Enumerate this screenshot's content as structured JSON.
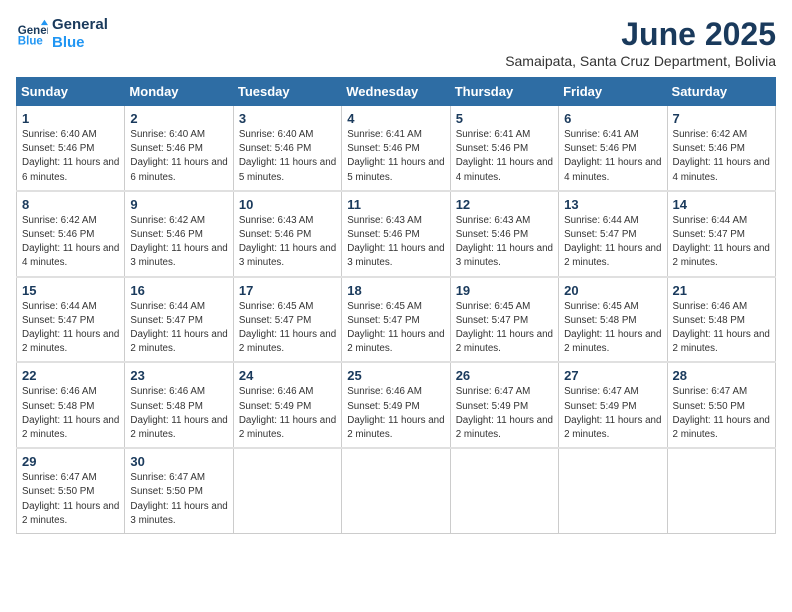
{
  "logo": {
    "line1": "General",
    "line2": "Blue"
  },
  "title": "June 2025",
  "subtitle": "Samaipata, Santa Cruz Department, Bolivia",
  "days_of_week": [
    "Sunday",
    "Monday",
    "Tuesday",
    "Wednesday",
    "Thursday",
    "Friday",
    "Saturday"
  ],
  "weeks": [
    [
      {
        "day": "1",
        "sunrise": "Sunrise: 6:40 AM",
        "sunset": "Sunset: 5:46 PM",
        "daylight": "Daylight: 11 hours and 6 minutes."
      },
      {
        "day": "2",
        "sunrise": "Sunrise: 6:40 AM",
        "sunset": "Sunset: 5:46 PM",
        "daylight": "Daylight: 11 hours and 6 minutes."
      },
      {
        "day": "3",
        "sunrise": "Sunrise: 6:40 AM",
        "sunset": "Sunset: 5:46 PM",
        "daylight": "Daylight: 11 hours and 5 minutes."
      },
      {
        "day": "4",
        "sunrise": "Sunrise: 6:41 AM",
        "sunset": "Sunset: 5:46 PM",
        "daylight": "Daylight: 11 hours and 5 minutes."
      },
      {
        "day": "5",
        "sunrise": "Sunrise: 6:41 AM",
        "sunset": "Sunset: 5:46 PM",
        "daylight": "Daylight: 11 hours and 4 minutes."
      },
      {
        "day": "6",
        "sunrise": "Sunrise: 6:41 AM",
        "sunset": "Sunset: 5:46 PM",
        "daylight": "Daylight: 11 hours and 4 minutes."
      },
      {
        "day": "7",
        "sunrise": "Sunrise: 6:42 AM",
        "sunset": "Sunset: 5:46 PM",
        "daylight": "Daylight: 11 hours and 4 minutes."
      }
    ],
    [
      {
        "day": "8",
        "sunrise": "Sunrise: 6:42 AM",
        "sunset": "Sunset: 5:46 PM",
        "daylight": "Daylight: 11 hours and 4 minutes."
      },
      {
        "day": "9",
        "sunrise": "Sunrise: 6:42 AM",
        "sunset": "Sunset: 5:46 PM",
        "daylight": "Daylight: 11 hours and 3 minutes."
      },
      {
        "day": "10",
        "sunrise": "Sunrise: 6:43 AM",
        "sunset": "Sunset: 5:46 PM",
        "daylight": "Daylight: 11 hours and 3 minutes."
      },
      {
        "day": "11",
        "sunrise": "Sunrise: 6:43 AM",
        "sunset": "Sunset: 5:46 PM",
        "daylight": "Daylight: 11 hours and 3 minutes."
      },
      {
        "day": "12",
        "sunrise": "Sunrise: 6:43 AM",
        "sunset": "Sunset: 5:46 PM",
        "daylight": "Daylight: 11 hours and 3 minutes."
      },
      {
        "day": "13",
        "sunrise": "Sunrise: 6:44 AM",
        "sunset": "Sunset: 5:47 PM",
        "daylight": "Daylight: 11 hours and 2 minutes."
      },
      {
        "day": "14",
        "sunrise": "Sunrise: 6:44 AM",
        "sunset": "Sunset: 5:47 PM",
        "daylight": "Daylight: 11 hours and 2 minutes."
      }
    ],
    [
      {
        "day": "15",
        "sunrise": "Sunrise: 6:44 AM",
        "sunset": "Sunset: 5:47 PM",
        "daylight": "Daylight: 11 hours and 2 minutes."
      },
      {
        "day": "16",
        "sunrise": "Sunrise: 6:44 AM",
        "sunset": "Sunset: 5:47 PM",
        "daylight": "Daylight: 11 hours and 2 minutes."
      },
      {
        "day": "17",
        "sunrise": "Sunrise: 6:45 AM",
        "sunset": "Sunset: 5:47 PM",
        "daylight": "Daylight: 11 hours and 2 minutes."
      },
      {
        "day": "18",
        "sunrise": "Sunrise: 6:45 AM",
        "sunset": "Sunset: 5:47 PM",
        "daylight": "Daylight: 11 hours and 2 minutes."
      },
      {
        "day": "19",
        "sunrise": "Sunrise: 6:45 AM",
        "sunset": "Sunset: 5:47 PM",
        "daylight": "Daylight: 11 hours and 2 minutes."
      },
      {
        "day": "20",
        "sunrise": "Sunrise: 6:45 AM",
        "sunset": "Sunset: 5:48 PM",
        "daylight": "Daylight: 11 hours and 2 minutes."
      },
      {
        "day": "21",
        "sunrise": "Sunrise: 6:46 AM",
        "sunset": "Sunset: 5:48 PM",
        "daylight": "Daylight: 11 hours and 2 minutes."
      }
    ],
    [
      {
        "day": "22",
        "sunrise": "Sunrise: 6:46 AM",
        "sunset": "Sunset: 5:48 PM",
        "daylight": "Daylight: 11 hours and 2 minutes."
      },
      {
        "day": "23",
        "sunrise": "Sunrise: 6:46 AM",
        "sunset": "Sunset: 5:48 PM",
        "daylight": "Daylight: 11 hours and 2 minutes."
      },
      {
        "day": "24",
        "sunrise": "Sunrise: 6:46 AM",
        "sunset": "Sunset: 5:49 PM",
        "daylight": "Daylight: 11 hours and 2 minutes."
      },
      {
        "day": "25",
        "sunrise": "Sunrise: 6:46 AM",
        "sunset": "Sunset: 5:49 PM",
        "daylight": "Daylight: 11 hours and 2 minutes."
      },
      {
        "day": "26",
        "sunrise": "Sunrise: 6:47 AM",
        "sunset": "Sunset: 5:49 PM",
        "daylight": "Daylight: 11 hours and 2 minutes."
      },
      {
        "day": "27",
        "sunrise": "Sunrise: 6:47 AM",
        "sunset": "Sunset: 5:49 PM",
        "daylight": "Daylight: 11 hours and 2 minutes."
      },
      {
        "day": "28",
        "sunrise": "Sunrise: 6:47 AM",
        "sunset": "Sunset: 5:50 PM",
        "daylight": "Daylight: 11 hours and 2 minutes."
      }
    ],
    [
      {
        "day": "29",
        "sunrise": "Sunrise: 6:47 AM",
        "sunset": "Sunset: 5:50 PM",
        "daylight": "Daylight: 11 hours and 2 minutes."
      },
      {
        "day": "30",
        "sunrise": "Sunrise: 6:47 AM",
        "sunset": "Sunset: 5:50 PM",
        "daylight": "Daylight: 11 hours and 3 minutes."
      },
      null,
      null,
      null,
      null,
      null
    ]
  ]
}
